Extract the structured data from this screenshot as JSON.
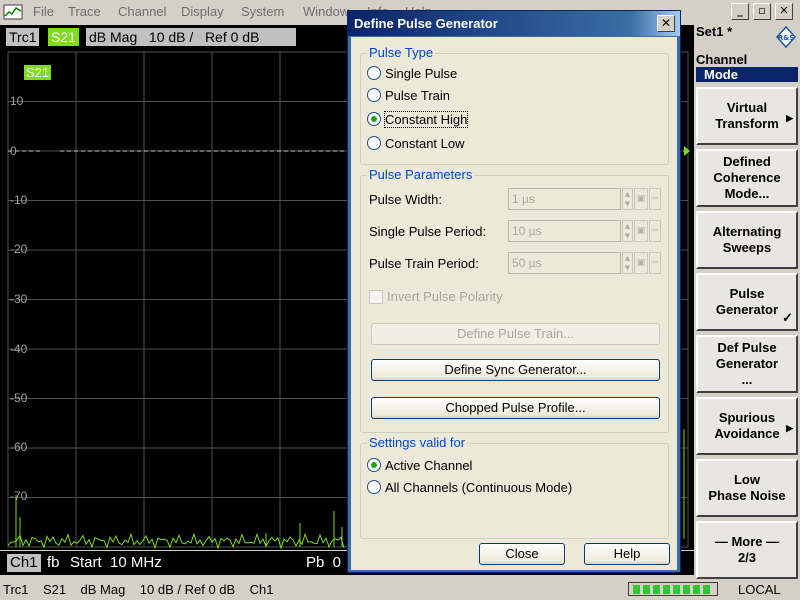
{
  "menubar": {
    "items": [
      "File",
      "Trace",
      "Channel",
      "Display",
      "System",
      "Window",
      "Info",
      "Help"
    ]
  },
  "trace_header": {
    "trace": "Trc1",
    "param": "S21",
    "rest": "dB Mag   10 dB /   Ref 0 dB"
  },
  "plot": {
    "trace_label": "S21",
    "y_ticks": [
      "10",
      "0",
      "-10",
      "-20",
      "-30",
      "-40",
      "-50",
      "-60",
      "-70"
    ],
    "colors": {
      "trace": "#7ddc1f",
      "grid": "#505050"
    }
  },
  "channel_footer": {
    "channel": "Ch1",
    "fb": "fb",
    "start": "Start  10 MHz",
    "pb": "Pb  0"
  },
  "statusbar": {
    "text": "Trc1    S21    dB Mag    10 dB / Ref 0 dB    Ch1",
    "local": "LOCAL"
  },
  "softpanel": {
    "set_label": "Set1 *",
    "group_title": "Channel",
    "mode_title": "Mode",
    "keys": [
      {
        "label": "Virtual\nTransform",
        "arrow": true,
        "check": false
      },
      {
        "label": "Defined\nCoherence\nMode...",
        "arrow": false,
        "check": false
      },
      {
        "label": "Alternating\nSweeps",
        "arrow": false,
        "check": false
      },
      {
        "label": "Pulse\nGenerator",
        "arrow": false,
        "check": true
      },
      {
        "label": "Def Pulse\nGenerator\n...",
        "arrow": false,
        "check": false
      },
      {
        "label": "Spurious\nAvoidance",
        "arrow": true,
        "check": false
      },
      {
        "label": "Low\nPhase Noise",
        "arrow": false,
        "check": false
      },
      {
        "label": "— More —\n2/3",
        "arrow": false,
        "check": false
      }
    ]
  },
  "dialog": {
    "title": "Define Pulse Generator",
    "pulse_type": {
      "title": "Pulse Type",
      "options": [
        "Single Pulse",
        "Pulse Train",
        "Constant High",
        "Constant Low"
      ],
      "selected": "Constant High"
    },
    "pulse_params": {
      "title": "Pulse Parameters",
      "pulse_width_label": "Pulse Width:",
      "pulse_width_value": "1 µs",
      "single_period_label": "Single Pulse Period:",
      "single_period_value": "10 µs",
      "train_period_label": "Pulse Train Period:",
      "train_period_value": "50 µs",
      "invert_label": "Invert Pulse Polarity",
      "define_train_label": "Define Pulse Train...",
      "define_sync_label": "Define Sync Generator...",
      "chopped_label": "Chopped Pulse Profile..."
    },
    "settings": {
      "title": "Settings valid for",
      "options": [
        "Active Channel",
        "All Channels (Continuous Mode)"
      ],
      "selected": "Active Channel"
    },
    "close_label": "Close",
    "help_label": "Help"
  }
}
